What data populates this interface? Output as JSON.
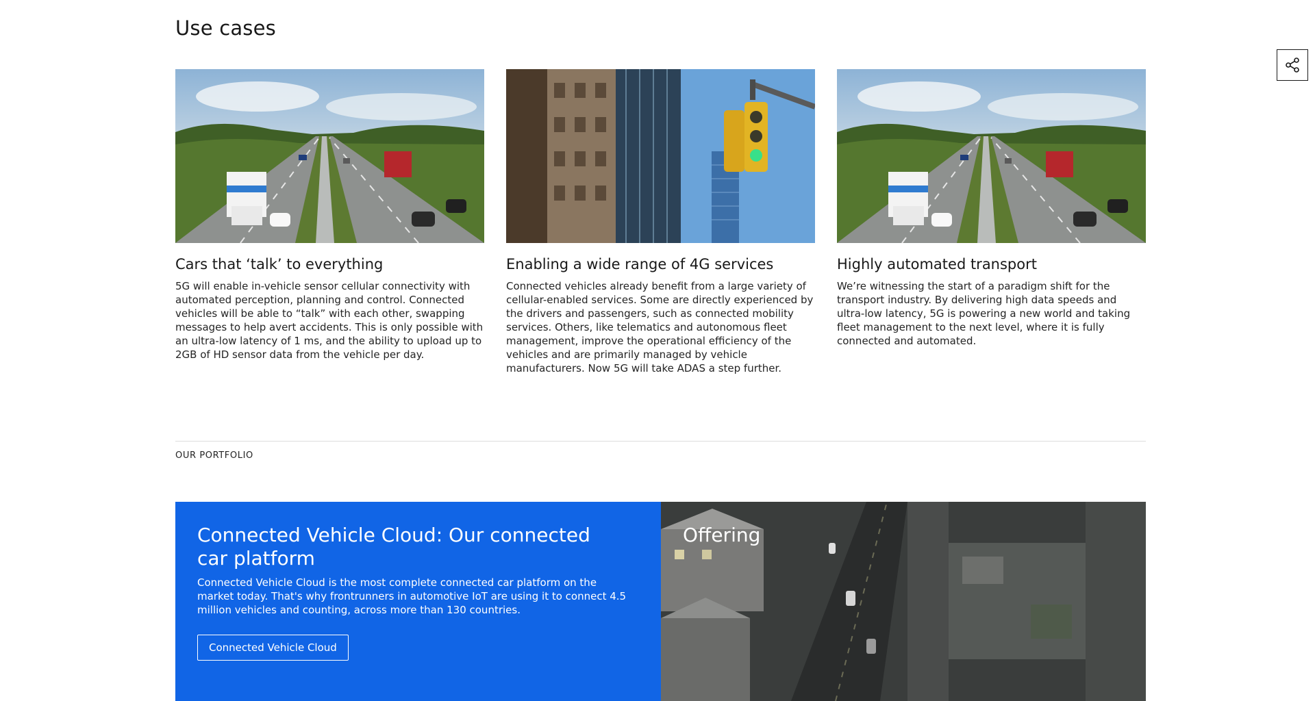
{
  "use_cases": {
    "title": "Use cases",
    "cards": [
      {
        "title": "Cars that ‘talk’ to everything",
        "text": "5G will enable in-vehicle sensor cellular connectivity with automated perception, planning and control. Connected vehicles will be able to “talk” with each other, swapping messages to help avert accidents. This is only possible with an ultra-low latency of 1 ms, and the ability to upload up to 2GB of HD sensor data from the vehicle per day.",
        "image": "highway-image"
      },
      {
        "title": "Enabling a wide range of 4G services",
        "text": "Connected vehicles already benefit from a large variety of cellular-enabled services. Some are directly experienced by the drivers and passengers, such as connected mobility services. Others, like telematics and autonomous fleet management, improve the operational efficiency of the vehicles and are primarily managed by vehicle manufacturers. Now 5G will take ADAS a step further.",
        "image": "traffic-light-image"
      },
      {
        "title": "Highly automated transport",
        "text": "We’re witnessing the start of a paradigm shift for the transport industry. By delivering high data speeds and ultra-low latency, 5G is powering a new world and taking fleet management to the next level, where it is fully connected and automated.",
        "image": "highway-image"
      }
    ]
  },
  "portfolio": {
    "eyebrow": "OUR PORTFOLIO",
    "title": "Connected Vehicle Cloud: Our connected car platform",
    "text": "Connected Vehicle Cloud is the most complete connected car platform on the market today. That's why frontrunners in automotive IoT are using it to connect 4.5 million vehicles and counting, across more than 130 countries.",
    "button_label": "Connected Vehicle Cloud",
    "offering_title": "Offering"
  },
  "share": {
    "icon": "share-icon"
  },
  "colors": {
    "accent_blue": "#1165e6",
    "text": "#181818"
  }
}
